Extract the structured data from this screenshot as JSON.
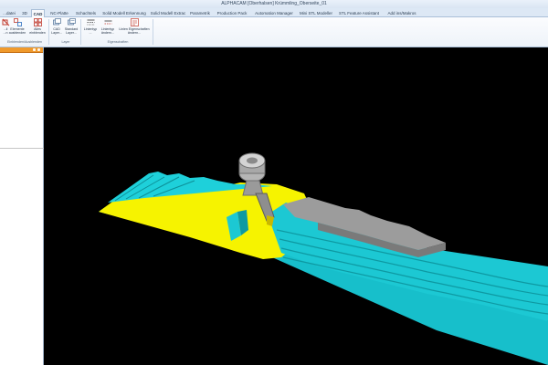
{
  "window": {
    "title": "ALPHACAM [Oberhalsen] Krümmling_Oberseite_01"
  },
  "tabs": [
    {
      "label": "...datei",
      "active": false
    },
    {
      "label": "3D",
      "active": false
    },
    {
      "label": "CAD",
      "active": true
    },
    {
      "label": "NC-Platte",
      "active": false
    },
    {
      "label": "Schachtels",
      "active": false
    },
    {
      "label": "Solid Modell Erkennung",
      "active": false
    },
    {
      "label": "Solid Modell Extrac",
      "active": false
    },
    {
      "label": "Parametrik",
      "active": false
    },
    {
      "label": "Production Pack",
      "active": false
    },
    {
      "label": "Automation Manager",
      "active": false
    },
    {
      "label": "Mini STL Modeller",
      "active": false
    },
    {
      "label": "STL Feature Assistant",
      "active": false
    },
    {
      "label": "Add ins/Makros",
      "active": false
    }
  ],
  "ribbon": {
    "buttons": [
      {
        "label": "...ll ...n",
        "icon": "hide-element-icon"
      },
      {
        "label": "Elemente ausblenden",
        "icon": "hide-elements-icon"
      },
      {
        "label": "Alles einblenden",
        "icon": "show-all-icon"
      },
      {
        "label": "CAD Layer...",
        "icon": "cad-layer-icon"
      },
      {
        "label": "Standard Layer...",
        "icon": "standard-layer-icon"
      },
      {
        "label": "Linientyp ...",
        "icon": "line-type-icon"
      },
      {
        "label": "Linientyp ändern...",
        "icon": "change-line-type-icon"
      },
      {
        "label": "Linien Eigenschaften ändern...",
        "icon": "line-properties-icon"
      }
    ],
    "groups": [
      {
        "label": "Einblenden/Ausblenden"
      },
      {
        "label": "Layer"
      },
      {
        "label": "Eigenschaften"
      }
    ]
  },
  "colors": {
    "accent_tab": "#dde8f5",
    "panel_header": "#f09a2c",
    "part_yellow": "#ffff00",
    "part_cyan": "#19c5cf",
    "stock_grey": "#9a9a9a",
    "viewport_bg": "#000000"
  }
}
